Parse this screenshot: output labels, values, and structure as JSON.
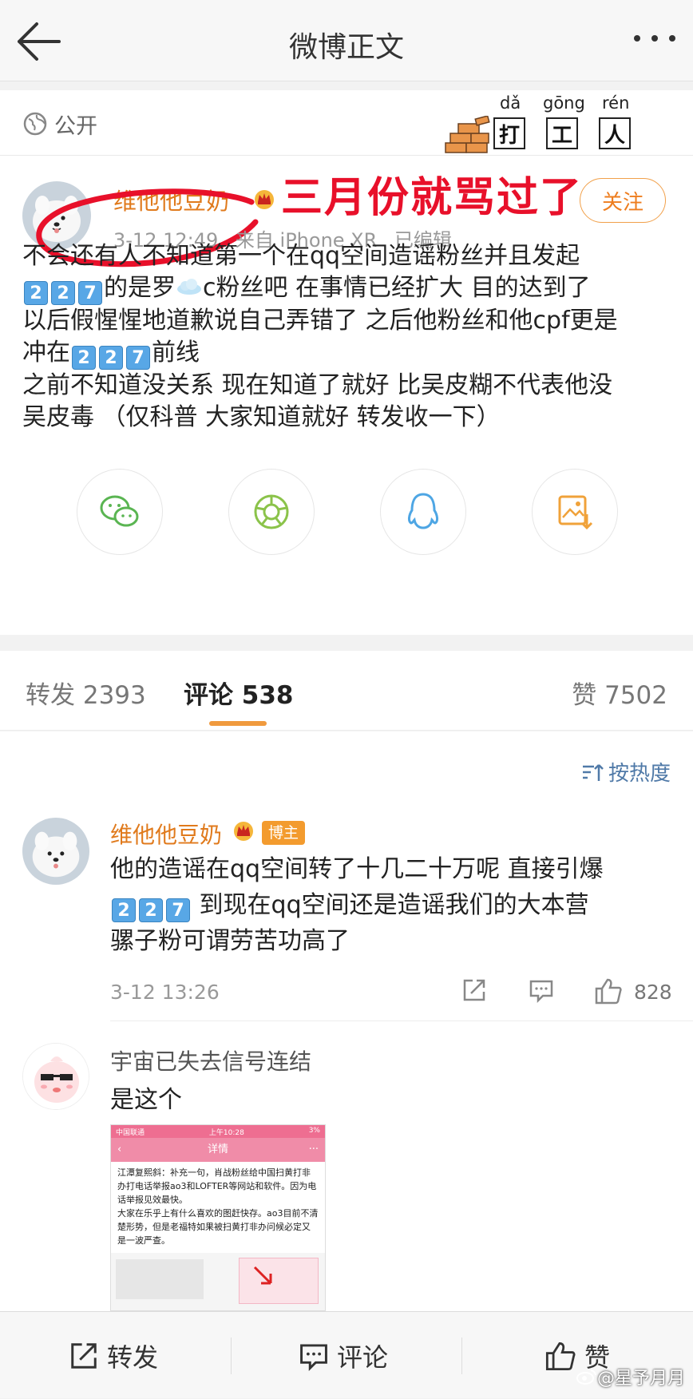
{
  "nav": {
    "title": "微博正文",
    "back_icon": "arrow-left-icon",
    "more_icon": "more-dots-icon"
  },
  "post": {
    "visibility": "公开",
    "sticker": {
      "pinyin": [
        "dǎ",
        "gōng",
        "rén"
      ],
      "chars": [
        "打",
        "工",
        "人"
      ]
    },
    "author": "维他他豆奶",
    "annotation": "三月份就骂过了",
    "follow_label": "关注",
    "time": "3-12 12:49",
    "source": "来自 iPhone XR",
    "edited": "已编辑",
    "lines": {
      "l1": "不会还有人不知道第一个在qq空间造谣粉丝并且发起",
      "l2_pre": "的是罗",
      "l2_post": "c粉丝吧 在事情已经扩大 目的达到了",
      "l3": "以后假惺惺地道歉说自己弄错了 之后他粉丝和他cpf更是",
      "l4_pre": "冲在",
      "l4_post": "前线",
      "l5": "之前不知道没关系 现在知道了就好 比吴皮糊不代表他没",
      "l6": "吴皮毒 （仅科普 大家知道就好 转发收一下）"
    },
    "keycaps": [
      "2",
      "2",
      "7"
    ],
    "share_icons": [
      "wechat-icon",
      "moments-icon",
      "qq-icon",
      "save-image-icon"
    ]
  },
  "tabs": {
    "repost": "转发 2393",
    "comment": "评论 538",
    "like": "赞 7502"
  },
  "comments": {
    "sort_label": "按热度",
    "items": [
      {
        "user": "维他他豆奶",
        "badge": "博主",
        "line1": "他的造谣在qq空间转了十几二十万呢 直接引爆",
        "line2_post": " 到现在qq空间还是造谣我们的大本营",
        "line3": "骡子粉可谓劳苦功高了",
        "time": "3-12 13:26",
        "likes": "828"
      },
      {
        "user": "宇宙已失去信号连结",
        "text": "是这个",
        "image": {
          "status_left": "中国联通",
          "status_mid": "上午10:28",
          "status_right": "3%",
          "header": "详情",
          "p1": "江潭复熙斜：补充一句，肖战粉丝给中国扫黄打非办打电话举报ao3和LOFTER等网站和软件。因为电话举报见效最快。",
          "p2": "大家在乐乎上有什么喜欢的图赶快存。ao3目前不清楚形势，但是老福特如果被扫黄打非办问候必定又是一波严查。"
        }
      }
    ]
  },
  "bottombar": {
    "repost": "转发",
    "comment": "评论",
    "like": "赞"
  },
  "watermark": "@星予月月",
  "colors": {
    "orange": "#e07a1c",
    "annotation_red": "#e8102a",
    "link_blue": "#507aa8"
  }
}
